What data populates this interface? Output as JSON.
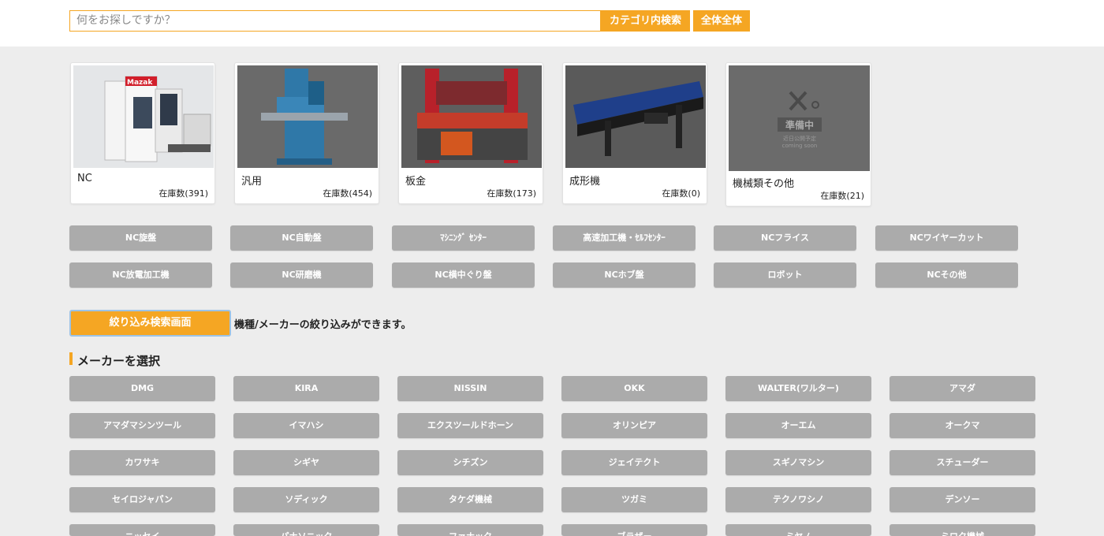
{
  "search": {
    "placeholder": "何をお探しですか？",
    "category_button": "カテゴリ内検索",
    "all_button": "全体全体"
  },
  "categories": [
    {
      "title": "NC",
      "stock": "在庫数(391)"
    },
    {
      "title": "汎用",
      "stock": "在庫数(454)"
    },
    {
      "title": "板金",
      "stock": "在庫数(173)"
    },
    {
      "title": "成形機",
      "stock": "在庫数(0)"
    },
    {
      "title": "機械類その他",
      "stock": "在庫数(21)"
    }
  ],
  "card_image_text": {
    "brand": "Mazak",
    "coming_title": "準備中",
    "coming_sub1": "近日公開予定",
    "coming_sub2": "coming soon"
  },
  "subcategories": [
    "NC旋盤",
    "NC自動盤",
    "ﾏｼﾆﾝｸﾞ ｾﾝﾀｰ",
    "高速加工機・ｾﾙﾌｾﾝﾀｰ",
    "NCフライス",
    "NCワイヤーカット",
    "NC放電加工機",
    "NC研磨機",
    "NC横中ぐり盤",
    "NCホブ盤",
    "ロボット",
    "NCその他"
  ],
  "filter": {
    "button_label": "絞り込み検索画面",
    "description": "機種/メーカーの絞り込みができます。"
  },
  "maker_section": {
    "title": "メーカーを選択",
    "makers": [
      "DMG",
      "KIRA",
      "NISSIN",
      "OKK",
      "WALTER(ワルター)",
      "アマダ",
      "アマダマシンツール",
      "イマハシ",
      "エクスツールドホーン",
      "オリンピア",
      "オーエム",
      "オークマ",
      "カワサキ",
      "シギヤ",
      "シチズン",
      "ジェイテクト",
      "スギノマシン",
      "スチューダー",
      "セイロジャパン",
      "ソディック",
      "タケダ機械",
      "ツガミ",
      "テクノワシノ",
      "デンソー",
      "ニッセイ",
      "パナソニック",
      "ファナック",
      "ブラザー",
      "ミヤノ",
      "ミロク機械"
    ]
  },
  "colors": {
    "accent": "#f5a623",
    "button_grey": "#ababab",
    "background": "#ededed"
  }
}
